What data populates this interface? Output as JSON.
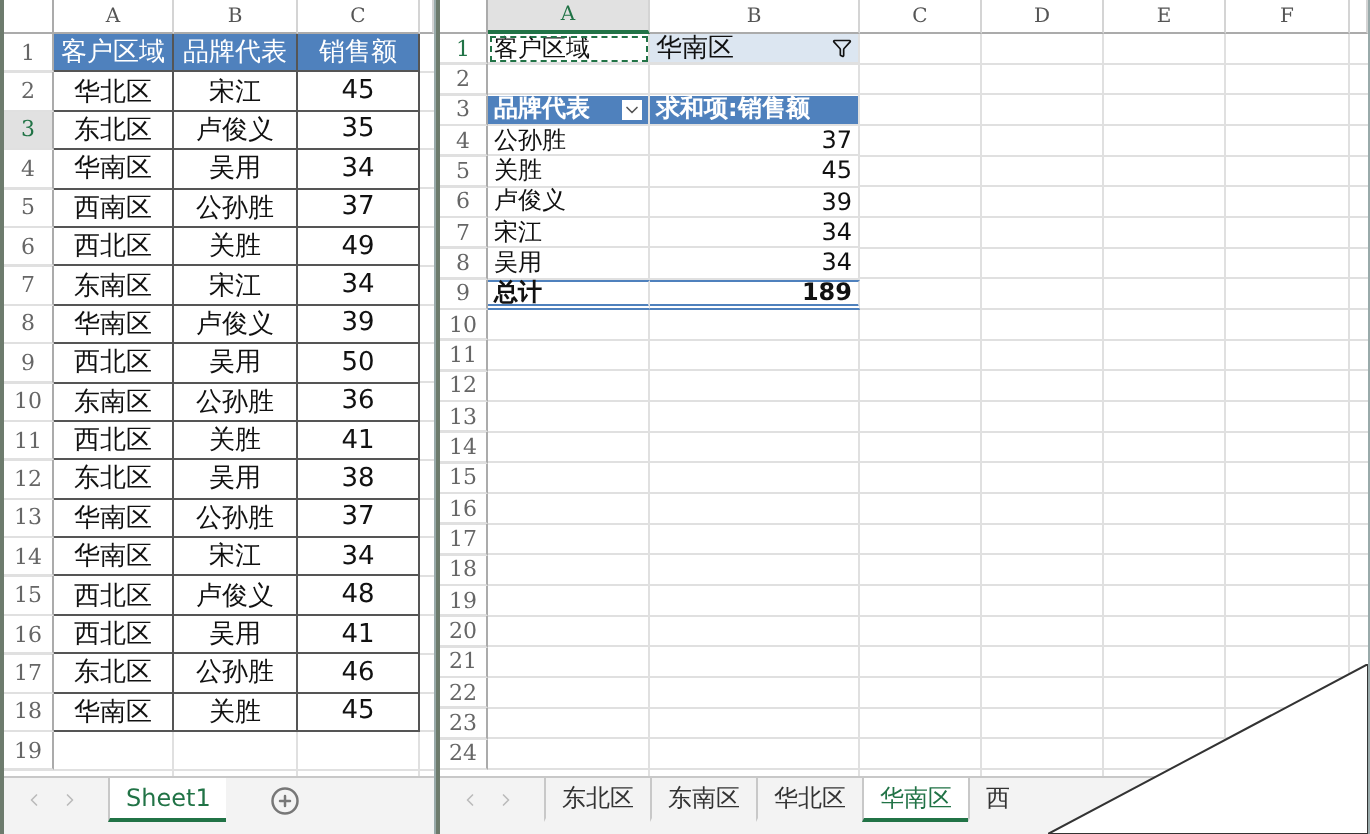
{
  "left_sheet": {
    "columns": [
      "A",
      "B",
      "C"
    ],
    "header": [
      "客户区域",
      "品牌代表",
      "销售额"
    ],
    "rows": [
      [
        "华北区",
        "宋江",
        "45"
      ],
      [
        "东北区",
        "卢俊义",
        "35"
      ],
      [
        "华南区",
        "吴用",
        "34"
      ],
      [
        "西南区",
        "公孙胜",
        "37"
      ],
      [
        "西北区",
        "关胜",
        "49"
      ],
      [
        "东南区",
        "宋江",
        "34"
      ],
      [
        "华南区",
        "卢俊义",
        "39"
      ],
      [
        "西北区",
        "吴用",
        "50"
      ],
      [
        "东南区",
        "公孙胜",
        "36"
      ],
      [
        "西北区",
        "关胜",
        "41"
      ],
      [
        "东北区",
        "吴用",
        "38"
      ],
      [
        "华南区",
        "公孙胜",
        "37"
      ],
      [
        "华南区",
        "宋江",
        "34"
      ],
      [
        "西北区",
        "卢俊义",
        "48"
      ],
      [
        "西北区",
        "吴用",
        "41"
      ],
      [
        "东北区",
        "公孙胜",
        "46"
      ],
      [
        "华南区",
        "关胜",
        "45"
      ]
    ],
    "row_numbers": [
      "1",
      "2",
      "3",
      "4",
      "5",
      "6",
      "7",
      "8",
      "9",
      "10",
      "11",
      "12",
      "13",
      "14",
      "15",
      "16",
      "17",
      "18",
      "19"
    ],
    "tabs": [
      {
        "label": "Sheet1",
        "selected": true
      }
    ]
  },
  "right_sheet": {
    "columns": [
      "A",
      "B",
      "C",
      "D",
      "E",
      "F"
    ],
    "row_numbers": [
      "1",
      "2",
      "3",
      "4",
      "5",
      "6",
      "7",
      "8",
      "9",
      "10",
      "11",
      "12",
      "13",
      "14",
      "15",
      "16",
      "17",
      "18",
      "19",
      "20",
      "21",
      "22",
      "23",
      "24"
    ],
    "filter": {
      "label": "客户区域",
      "value": "华南区"
    },
    "pivot_header": [
      "品牌代表",
      "求和项:销售额"
    ],
    "pivot_rows": [
      [
        "公孙胜",
        "37"
      ],
      [
        "关胜",
        "45"
      ],
      [
        "卢俊义",
        "39"
      ],
      [
        "宋江",
        "34"
      ],
      [
        "吴用",
        "34"
      ]
    ],
    "total": [
      "总计",
      "189"
    ],
    "tabs": [
      {
        "label": "东北区",
        "selected": false
      },
      {
        "label": "东南区",
        "selected": false
      },
      {
        "label": "华北区",
        "selected": false
      },
      {
        "label": "华南区",
        "selected": true
      },
      {
        "label": "西",
        "selected": false
      }
    ]
  }
}
